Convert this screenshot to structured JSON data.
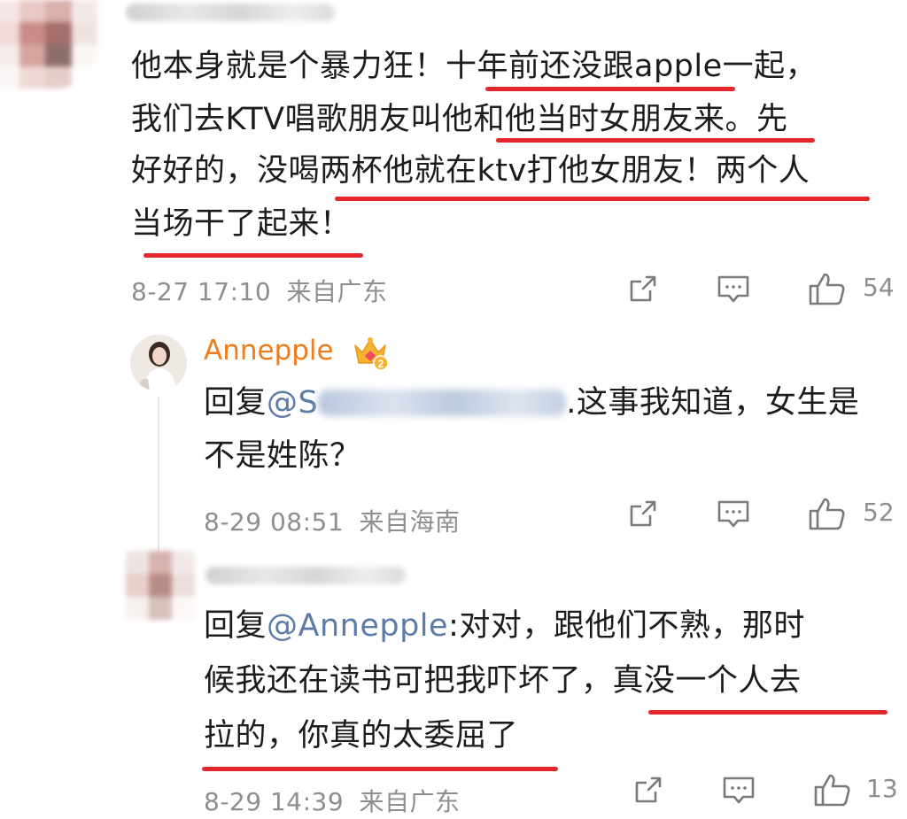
{
  "comments": [
    {
      "id": "top",
      "text_lines": [
        "他本身就是个暴力狂！十年前还没跟apple一起，",
        "我们去KTV唱歌朋友叫他和他当时女朋友来。先",
        "好好的，没喝两杯他就在ktv打他女朋友！两个人",
        "当场干了起来！"
      ],
      "date": "8-27 17:10",
      "location": "来自广东",
      "likes": "54"
    },
    {
      "id": "reply-1",
      "username": "Annepple",
      "badge_icon": "crown-badge-icon",
      "reply_prefix": "回复",
      "mention": "@S",
      "text_lines": [
        ".这事我知道，女生是",
        "不是姓陈？"
      ],
      "date": "8-29 08:51",
      "location": "来自海南",
      "likes": "52"
    },
    {
      "id": "reply-2",
      "reply_prefix": "回复",
      "mention": "@Annepple",
      "text_lines": [
        ":对对，跟他们不熟，那时",
        "候我还在读书可把我吓坏了，真没一个人去",
        "拉的，你真的太委屈了"
      ],
      "date": "8-29 14:39",
      "location": "来自广东",
      "likes": "13"
    }
  ],
  "colors": {
    "highlight_underline": "#e5262c",
    "mention": "#5d7ba8",
    "username": "#ef7b1a",
    "meta": "#8e8e8e"
  },
  "icons": [
    "share-icon",
    "comment-icon",
    "like-icon"
  ]
}
